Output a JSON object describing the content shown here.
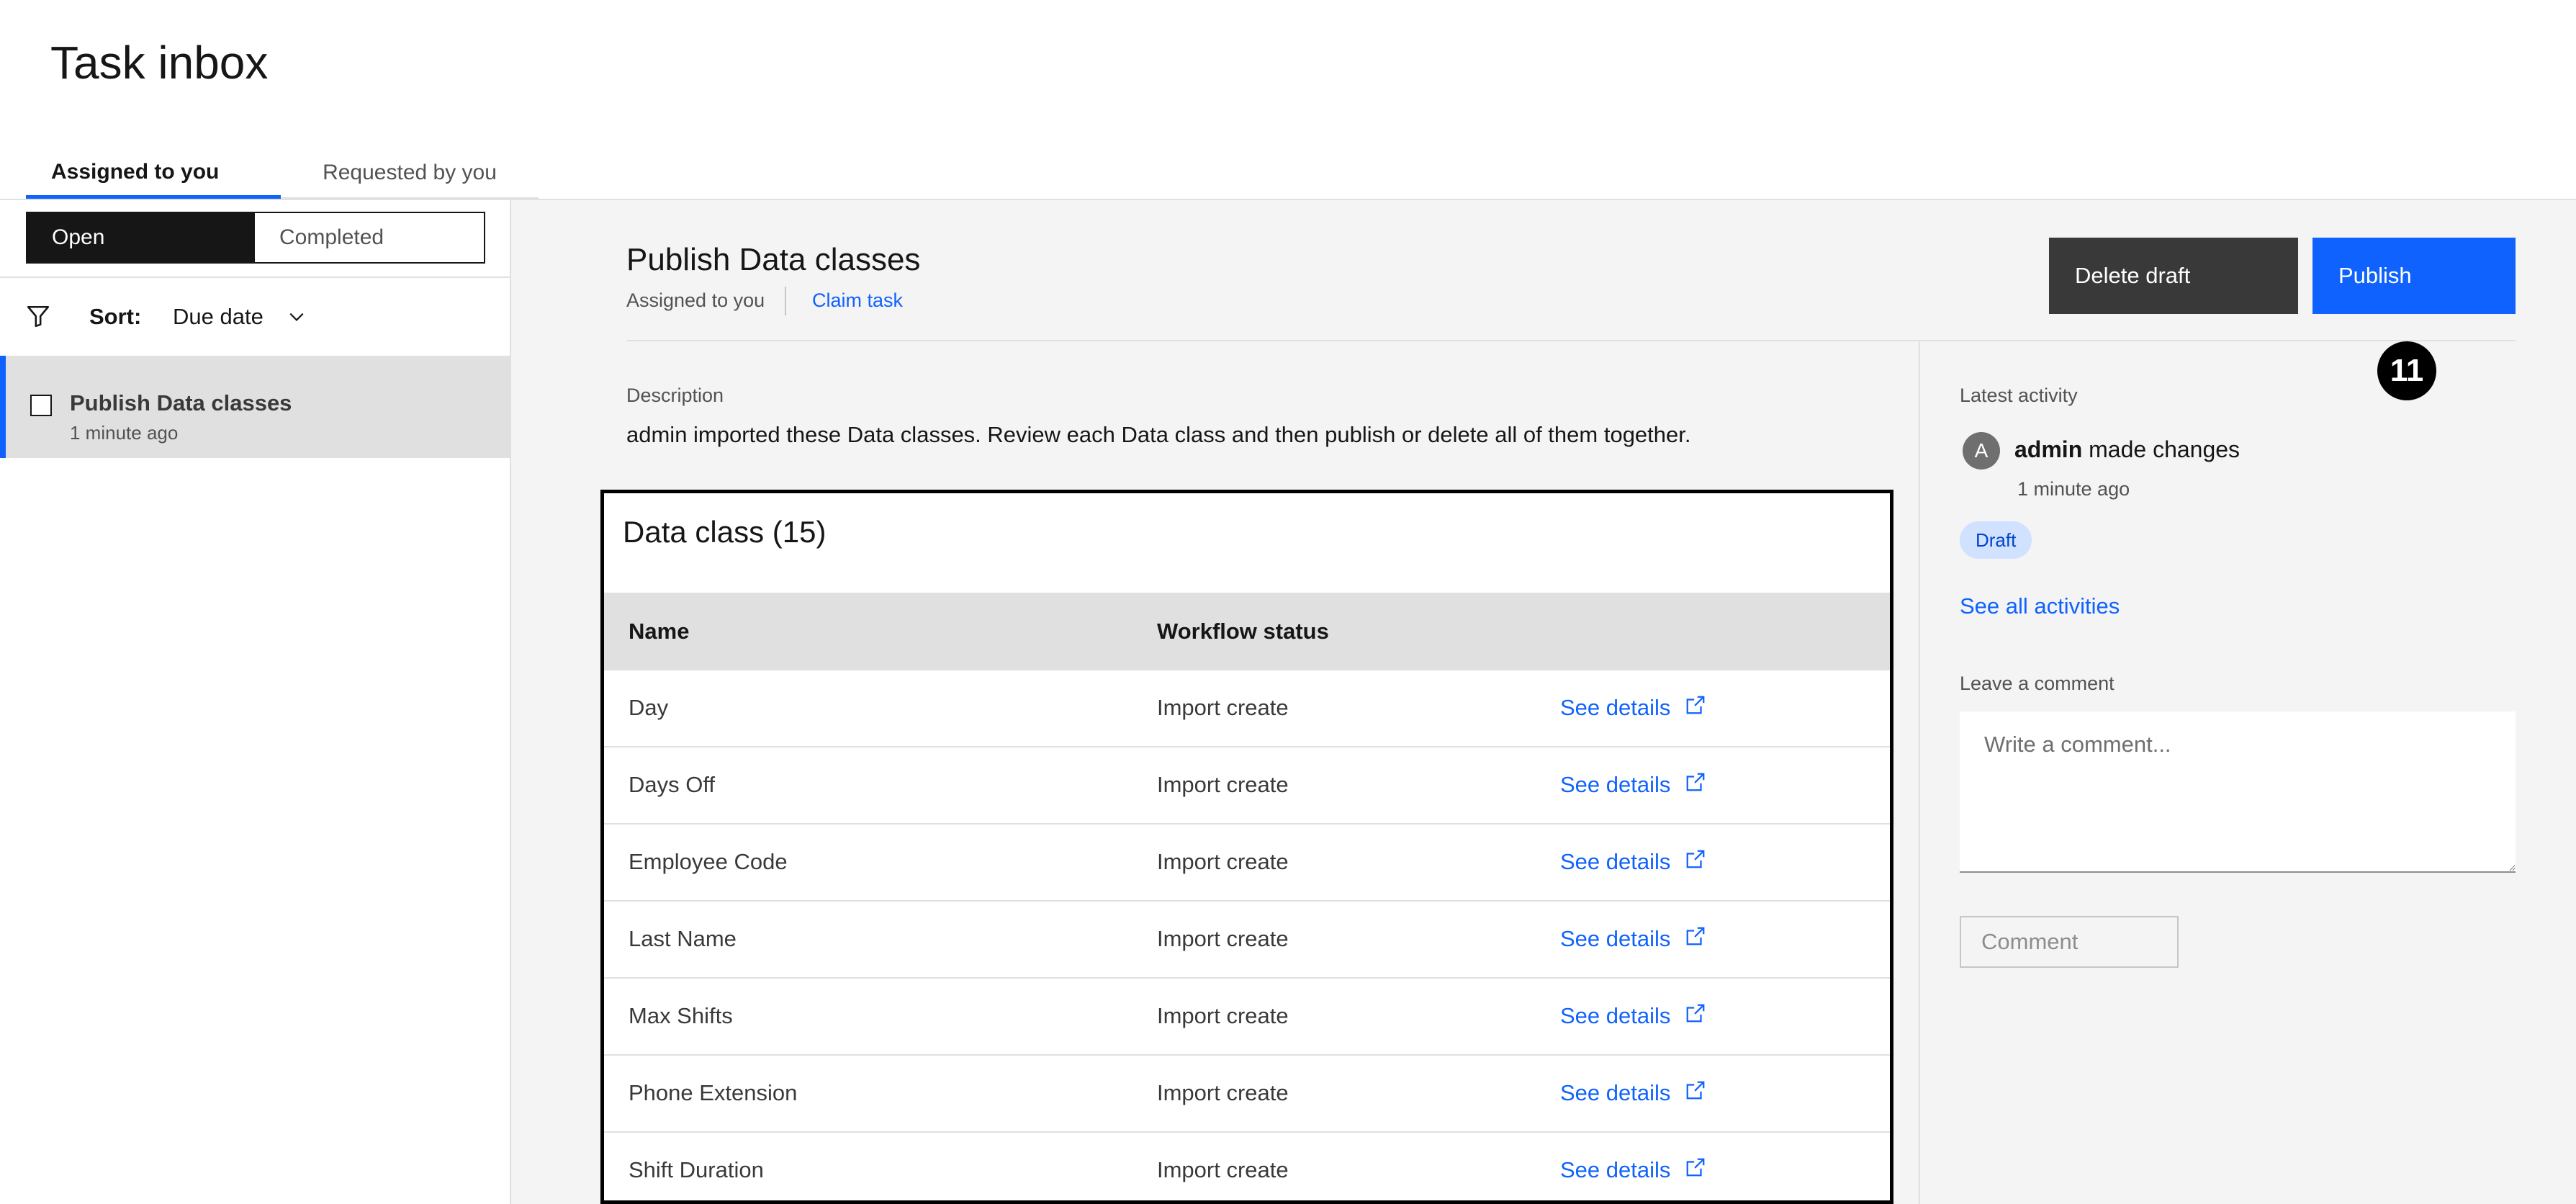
{
  "page": {
    "title": "Task inbox"
  },
  "tabs": [
    {
      "label": "Assigned to you",
      "active": true
    },
    {
      "label": "Requested by you",
      "active": false
    }
  ],
  "sidebar": {
    "segment": {
      "open": "Open",
      "completed": "Completed",
      "selected": "Open"
    },
    "sort": {
      "label": "Sort:",
      "value": "Due date"
    },
    "icons": {
      "filter": "filter-icon",
      "chevron": "chevron-down-icon"
    },
    "items": [
      {
        "title": "Publish Data classes",
        "time": "1 minute ago",
        "selected": true
      }
    ]
  },
  "task": {
    "title": "Publish Data classes",
    "assigned": "Assigned to you",
    "claim": "Claim task",
    "delete_label": "Delete draft",
    "publish_label": "Publish",
    "step_badge": "11",
    "description_label": "Description",
    "description": "admin imported these Data classes. Review each Data class and then publish or delete all of them together."
  },
  "table": {
    "title": "Data class (15)",
    "headers": {
      "name": "Name",
      "status": "Workflow status",
      "link": ""
    },
    "rows": [
      {
        "name": "Day",
        "status": "Import create",
        "link": "See details"
      },
      {
        "name": "Days Off",
        "status": "Import create",
        "link": "See details"
      },
      {
        "name": "Employee Code",
        "status": "Import create",
        "link": "See details"
      },
      {
        "name": "Last Name",
        "status": "Import create",
        "link": "See details"
      },
      {
        "name": "Max Shifts",
        "status": "Import create",
        "link": "See details"
      },
      {
        "name": "Phone Extension",
        "status": "Import create",
        "link": "See details"
      },
      {
        "name": "Shift Duration",
        "status": "Import create",
        "link": "See details"
      }
    ]
  },
  "activity": {
    "label": "Latest activity",
    "avatar_initial": "A",
    "user": "admin",
    "action": "made changes",
    "time": "1 minute ago",
    "tag": "Draft",
    "see_all": "See all activities"
  },
  "comment": {
    "label": "Leave a comment",
    "placeholder": "Write a comment...",
    "button": "Comment"
  },
  "colors": {
    "accent": "#0f62fe",
    "dark_button": "#393939",
    "tag_bg": "#d0e2ff",
    "panel_bg": "#f4f4f4"
  }
}
